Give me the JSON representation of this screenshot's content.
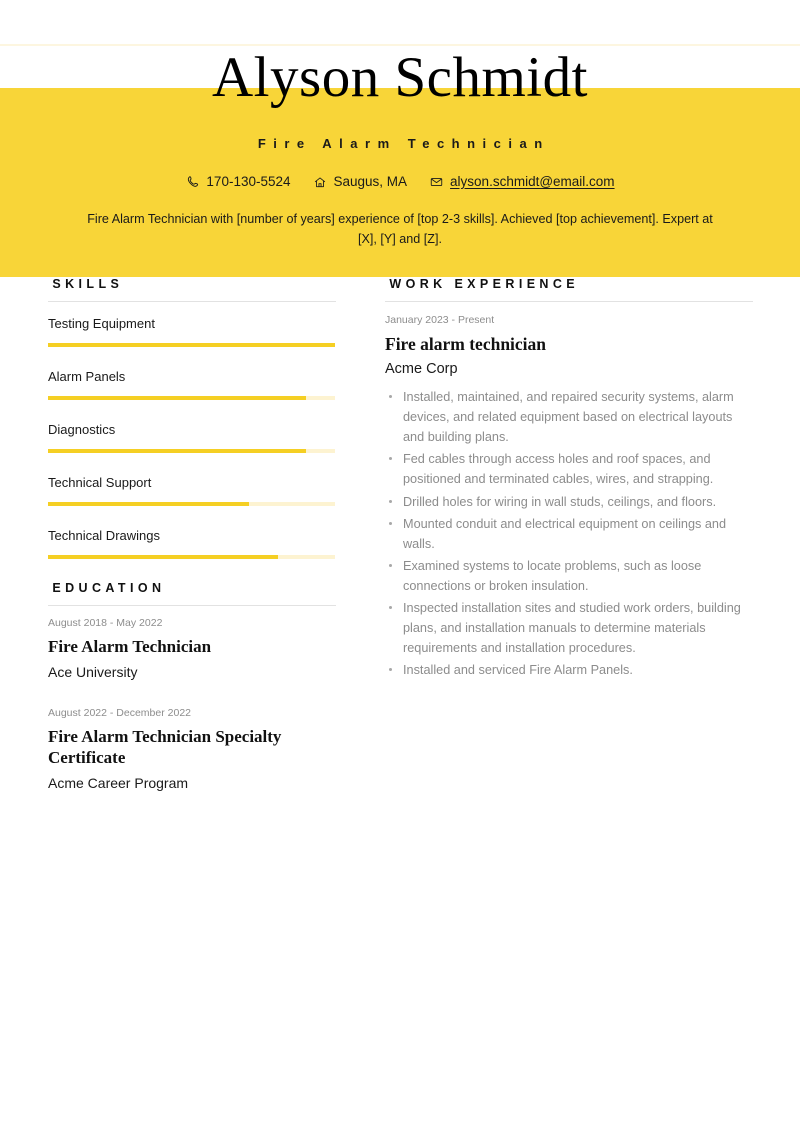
{
  "theme": {
    "accent": "#f8d538",
    "bar_fill": "#f5cf23",
    "bar_track": "#fdf3d1",
    "rule": "#e2e2e2",
    "muted_text": "#8c8c8c"
  },
  "header": {
    "full_name": "Alyson Schmidt",
    "job_title": "Fire Alarm Technician",
    "contacts": [
      {
        "icon": "phone-icon",
        "value": "170-130-5524"
      },
      {
        "icon": "location-pin-icon",
        "value": "Saugus, MA"
      },
      {
        "icon": "envelope-icon",
        "value": "alyson.schmidt@email.com"
      }
    ],
    "summary": "Fire Alarm Technician with [number of years] experience of [top 2-3 skills]. Achieved [top achievement]. Expert at [X], [Y] and [Z]."
  },
  "skills": {
    "section_title": "SKILLS",
    "items": [
      {
        "name": "Testing Equipment",
        "level": 100
      },
      {
        "name": "Alarm Panels",
        "level": 90
      },
      {
        "name": "Diagnostics",
        "level": 90
      },
      {
        "name": "Technical Support",
        "level": 70
      },
      {
        "name": "Technical Drawings",
        "level": 80
      }
    ]
  },
  "education": {
    "section_title": "EDUCATION",
    "entries": [
      {
        "date": "August 2018 - May 2022",
        "title": "Fire Alarm Technician",
        "org": "Ace University"
      },
      {
        "date": "August 2022 - December 2022",
        "title": "Fire Alarm Technician Specialty Certificate",
        "org": "Acme Career Program"
      }
    ]
  },
  "work_experience": {
    "section_title": "WORK EXPERIENCE",
    "entries": [
      {
        "date": "January 2023 - Present",
        "title": "Fire alarm technician",
        "org": "Acme Corp",
        "bullets": [
          "Installed, maintained, and repaired security systems, alarm devices, and related equipment based on electrical layouts and building plans.",
          "Fed cables through access holes and roof spaces, and positioned and terminated cables, wires, and strapping.",
          "Drilled holes for wiring in wall studs, ceilings, and floors.",
          "Mounted conduit and electrical equipment on ceilings and walls.",
          "Examined systems to locate problems, such as loose connections or broken insulation.",
          "Inspected installation sites and studied work orders, building plans, and installation manuals to determine materials requirements and installation procedures.",
          "Installed and serviced Fire Alarm Panels."
        ]
      }
    ]
  }
}
